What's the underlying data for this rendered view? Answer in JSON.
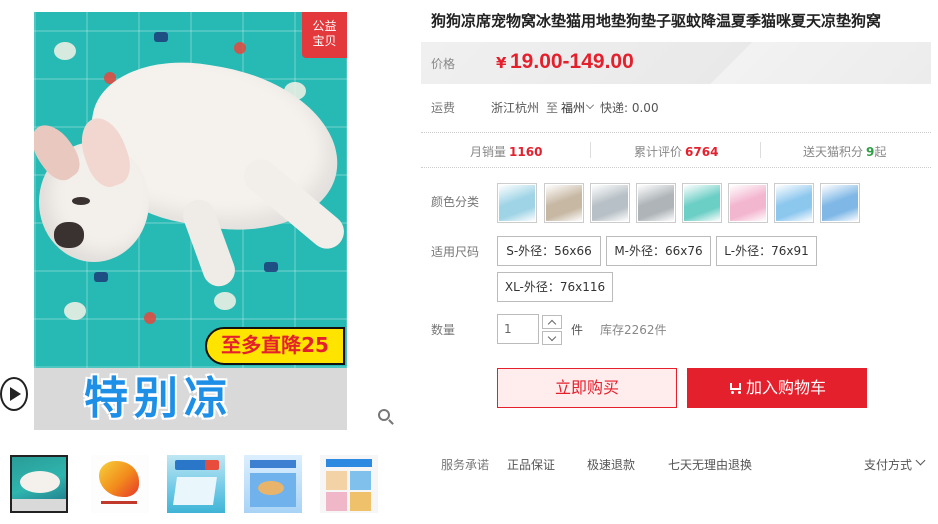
{
  "gallery": {
    "promo_badge": "公益\n宝贝",
    "discount_tag": "至多直降25",
    "slogan": "特别凉"
  },
  "product": {
    "title": "狗狗凉席宠物窝冰垫猫用地垫狗垫子驱蚊降温夏季猫咪夏天凉垫狗窝"
  },
  "price": {
    "label": "价格",
    "currency": "¥",
    "value": "19.00-149.00",
    "color": "#e4202d"
  },
  "shipping": {
    "label": "运费",
    "from": "浙江杭州",
    "to_word": "至",
    "to_city": "福州",
    "express": "快递: 0.00"
  },
  "stats": {
    "monthly_sales_label": "月销量",
    "monthly_sales": "1160",
    "reviews_label": "累计评价",
    "reviews": "6764",
    "points_label": "送天猫积分",
    "points": "9",
    "points_suffix": "起"
  },
  "color_option": {
    "label": "颜色分类",
    "swatches": [
      {
        "icon": "dog-on-cool-mat",
        "color": "#9fd4e6"
      },
      {
        "icon": "dog-on-cool-mat",
        "color": "#c7b8a3"
      },
      {
        "icon": "dog-on-grey-mat",
        "color": "#b7c0c6"
      },
      {
        "icon": "dog-on-grey-mat",
        "color": "#aeb4b8"
      },
      {
        "icon": "blue-pattern-mat",
        "color": "#6ccfc6"
      },
      {
        "icon": "pink-pattern-mat",
        "color": "#f3b6cf"
      },
      {
        "icon": "dog-on-blue-mat",
        "color": "#8cc7ee"
      },
      {
        "icon": "dog-on-blue-mat",
        "color": "#7fb8e6"
      }
    ]
  },
  "size_option": {
    "label": "适用尺码",
    "options": [
      "S-外径：56x66",
      "M-外径：66x76",
      "L-外径：76x91",
      "XL-外径：76x116"
    ]
  },
  "quantity": {
    "label": "数量",
    "value": "1",
    "unit": "件",
    "stock": "库存2262件"
  },
  "actions": {
    "buy_now": "立即购买",
    "add_to_cart": "加入购物车"
  },
  "services": {
    "label": "服务承诺",
    "items": [
      "正品保证",
      "极速退款",
      "七天无理由退换"
    ],
    "payment": "支付方式"
  }
}
